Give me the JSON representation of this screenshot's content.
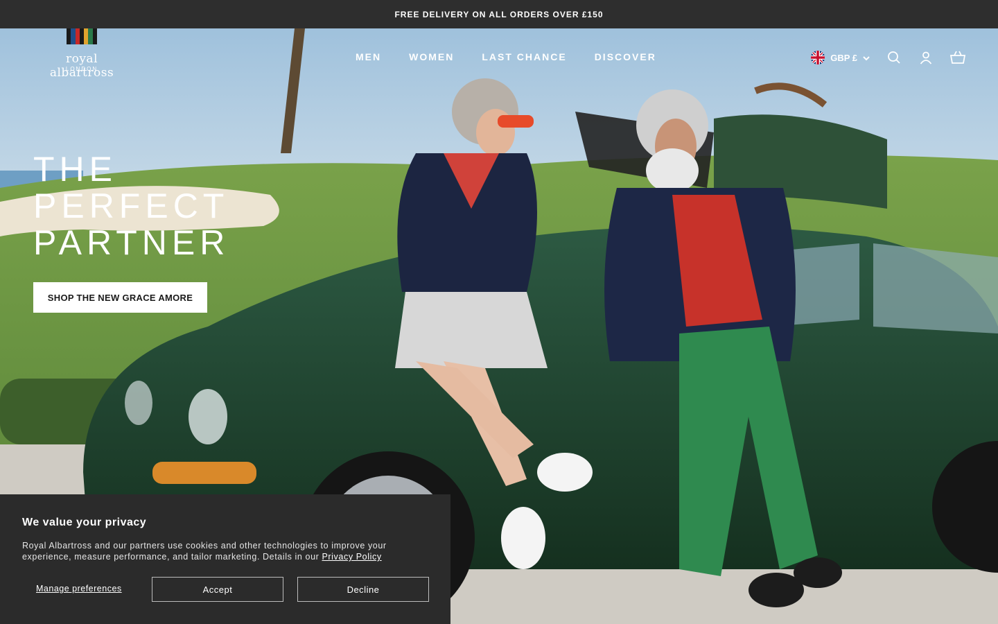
{
  "announcement": "FREE DELIVERY ON ALL ORDERS OVER £150",
  "logo": {
    "name": "royal albartross",
    "sub": "LONDON"
  },
  "nav": [
    {
      "label": "MEN"
    },
    {
      "label": "WOMEN"
    },
    {
      "label": "LAST CHANCE"
    },
    {
      "label": "DISCOVER"
    }
  ],
  "header_utils": {
    "currency": "GBP £",
    "icons": [
      "uk-flag-icon",
      "chevron-down-icon",
      "search-icon",
      "account-icon",
      "basket-icon"
    ]
  },
  "hero": {
    "title_lines": [
      "THE",
      "PERFECT",
      "PARTNER"
    ],
    "cta": "SHOP THE NEW GRACE AMORE"
  },
  "cookie": {
    "title": "We value your privacy",
    "body": "Royal Albartross and our partners use cookies and other technologies to improve your experience, measure performance, and tailor marketing. Details in our",
    "link": "Privacy Policy",
    "manage": "Manage preferences",
    "accept": "Accept",
    "decline": "Decline"
  },
  "colors": {
    "announce_bg": "#2e2e2e",
    "cookie_bg": "#2b2b2b",
    "car_green": "#1f3d2c",
    "sky": "#a9c9df",
    "grass": "#6f9a45"
  }
}
